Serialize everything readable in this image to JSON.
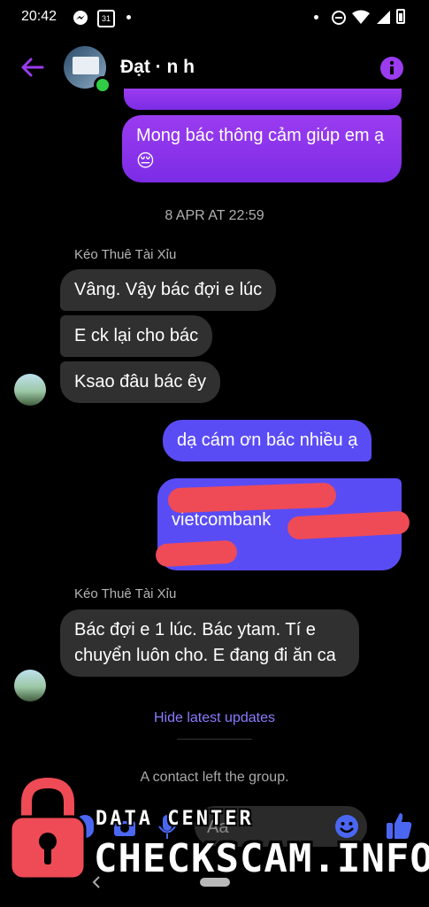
{
  "status_bar": {
    "time": "20:42",
    "calendar_day": "31"
  },
  "header": {
    "contact_name": "Đạt · n h"
  },
  "messages": {
    "out1": "Mong bác thông cảm giúp em ạ 😔",
    "timestamp": "8 APR AT 22:59",
    "sender1": "Kéo Thuê Tài Xỉu",
    "in1": "Vâng. Vậy bác đợi e lúc",
    "in2": "E ck lại cho bác",
    "in3": "Ksao đâu bác êy",
    "out2": "dạ cám ơn bác nhiều ạ",
    "out3_line1": "vietcombank",
    "sender2": "Kéo Thuê Tài Xỉu",
    "in4": "Bác đợi e 1 lúc. Bác ytam. Tí e chuyển luôn cho. E đang đi ăn ca"
  },
  "hide_updates": "Hide latest updates",
  "system_notice": "A contact left the group.",
  "composer": {
    "placeholder": "Aa"
  },
  "watermark": {
    "line1": "DATA CENTER",
    "line2": "CHECKSCAM.INFO"
  },
  "colors": {
    "accent": "#9b3cf0",
    "blue_bubble": "#5a4cf5",
    "incoming": "#303030",
    "watermark_red": "#ef4b56"
  }
}
